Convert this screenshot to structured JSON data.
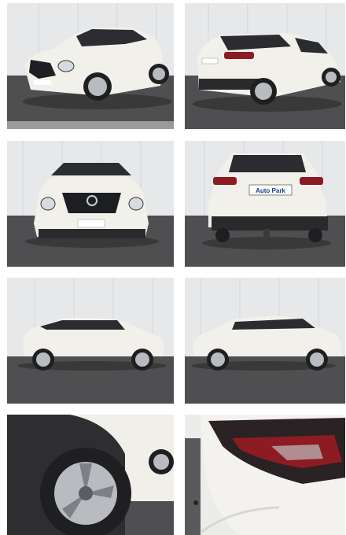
{
  "gallery": {
    "photos": [
      {
        "view": "front-three-quarter"
      },
      {
        "view": "rear-three-quarter"
      },
      {
        "view": "front"
      },
      {
        "view": "rear"
      },
      {
        "view": "left-side"
      },
      {
        "view": "right-side"
      },
      {
        "view": "wheel-closeup"
      },
      {
        "view": "taillight-closeup"
      }
    ],
    "dealer_plate": "Auto Park",
    "colors": {
      "car_body": "#f1efea",
      "wall": "#e6e7e8",
      "ground": "#4d4d4f",
      "glass": "#2a2c30",
      "taillight": "#8c1c22"
    }
  }
}
